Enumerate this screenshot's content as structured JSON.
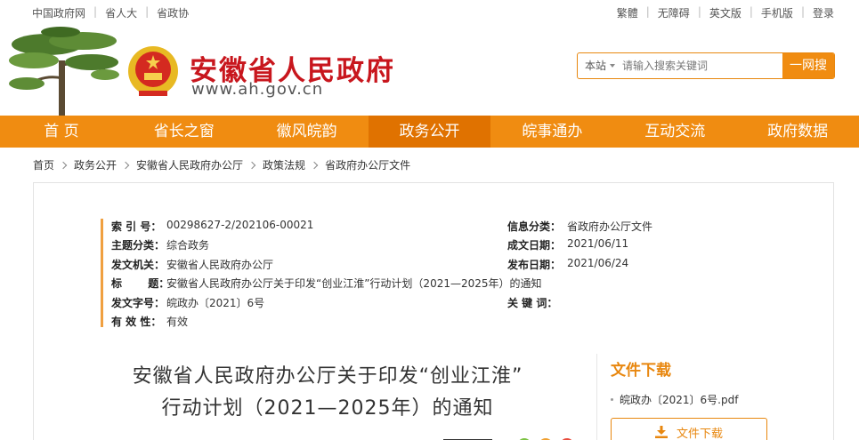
{
  "topbar": {
    "left_links": [
      "中国政府网",
      "省人大",
      "省政协"
    ],
    "right_links": [
      "繁體",
      "无障碍",
      "英文版",
      "手机版",
      "登录"
    ]
  },
  "header": {
    "site_name": "安徽省人民政府",
    "site_url": "www.ah.gov.cn"
  },
  "search": {
    "scope": "本站",
    "placeholder": "请输入搜索关键词",
    "button": "一网搜"
  },
  "nav": {
    "items": [
      "首 页",
      "省长之窗",
      "徽风皖韵",
      "政务公开",
      "皖事通办",
      "互动交流",
      "政府数据"
    ],
    "active_index": 3
  },
  "breadcrumb": [
    "首页",
    "政务公开",
    "安徽省人民政府办公厅",
    "政策法规",
    "省政府办公厅文件"
  ],
  "meta": {
    "index_label": "索 引 号：",
    "index_value": "00298627-2/202106-00021",
    "info_cat_label": "信息分类：",
    "info_cat_value": "省政府办公厅文件",
    "topic_label": "主题分类：",
    "topic_value": "综合政务",
    "created_label": "成文日期：",
    "created_value": "2021/06/11",
    "issuer_label": "发文机关：",
    "issuer_value": "安徽省人民政府办公厅",
    "published_label": "发布日期：",
    "published_value": "2021/06/24",
    "title_label": "标       题：",
    "title_value": "安徽省人民政府办公厅关于印发“创业江淮”行动计划（2021—2025年）的通知",
    "docno_label": "发文字号：",
    "docno_value": "皖政办〔2021〕6号",
    "keywords_label": "关 键 词：",
    "keywords_value": "",
    "validity_label": "有 效 性：",
    "validity_value": "有效"
  },
  "document": {
    "title_line1": "安徽省人民政府办公厅关于印发“创业江淮”",
    "title_line2": "行动计划（2021—2025年）的通知"
  },
  "download": {
    "heading": "文件下载",
    "file_name": "皖政办〔2021〕6号.pdf",
    "button": "文件下载"
  },
  "colors": {
    "brand_red": "#c8161d",
    "nav_orange": "#f08c11",
    "nav_active": "#e07200",
    "accent_orange": "#e8870f"
  },
  "icons": [
    "pine-tree-logo",
    "national-emblem-icon",
    "dropdown-caret-icon",
    "download-icon",
    "bullet-dot-icon",
    "share-icon"
  ]
}
